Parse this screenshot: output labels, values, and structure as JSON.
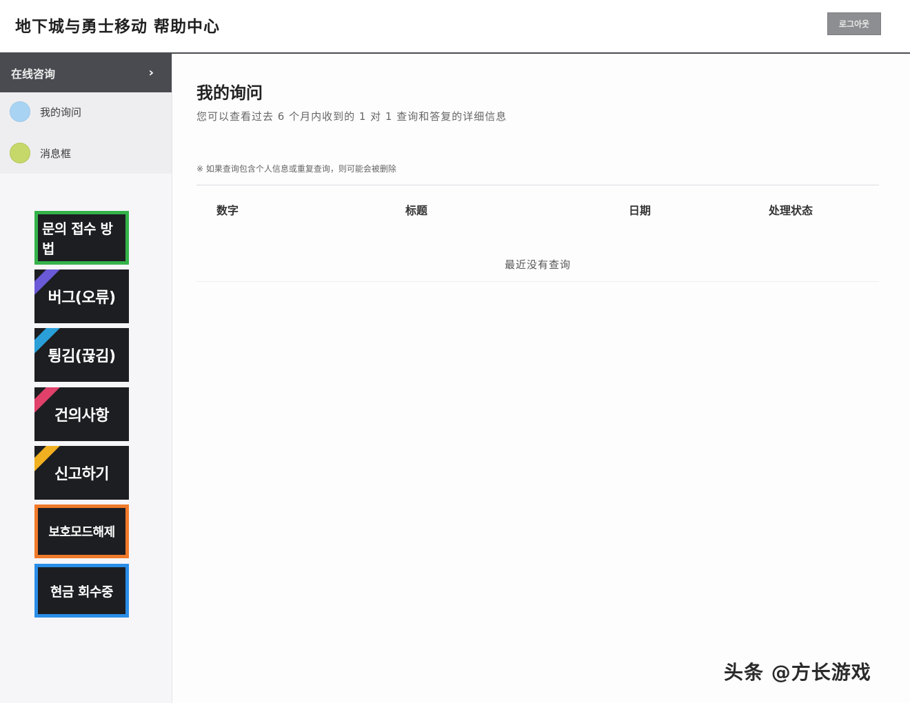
{
  "header": {
    "title": "地下城与勇士移动 帮助中心",
    "logout_label": "로그아웃"
  },
  "sidebar": {
    "section_label": "在线咨询",
    "items": [
      {
        "label": "我的询问",
        "dot_color": "#a9d3f2"
      },
      {
        "label": "消息框",
        "dot_color": "#c7d86a"
      }
    ],
    "banners": [
      {
        "label": "문의 접수 방법",
        "border_color": "#34b34a"
      },
      {
        "label": "버그(오류)",
        "ribbon_color": "#6a5ad8"
      },
      {
        "label": "튕김(끊김)",
        "ribbon_color": "#2a9fd8"
      },
      {
        "label": "건의사항",
        "ribbon_color": "#e0406a"
      },
      {
        "label": "신고하기",
        "ribbon_color": "#f0b020"
      },
      {
        "label": "보호모드해제",
        "border_color": "#f07a2a"
      },
      {
        "label": "현금 회수중",
        "border_color": "#2a8ee8"
      }
    ]
  },
  "main": {
    "title": "我的询问",
    "description": "您可以查看过去 6 个月内收到的 1 对 1 查询和答复的详细信息",
    "notice": "※ 如果查询包含个人信息或重复查询，则可能会被删除",
    "columns": [
      "数字",
      "标题",
      "日期",
      "处理状态"
    ],
    "empty_message": "最近没有查询"
  },
  "watermark": "头条 @方长游戏"
}
